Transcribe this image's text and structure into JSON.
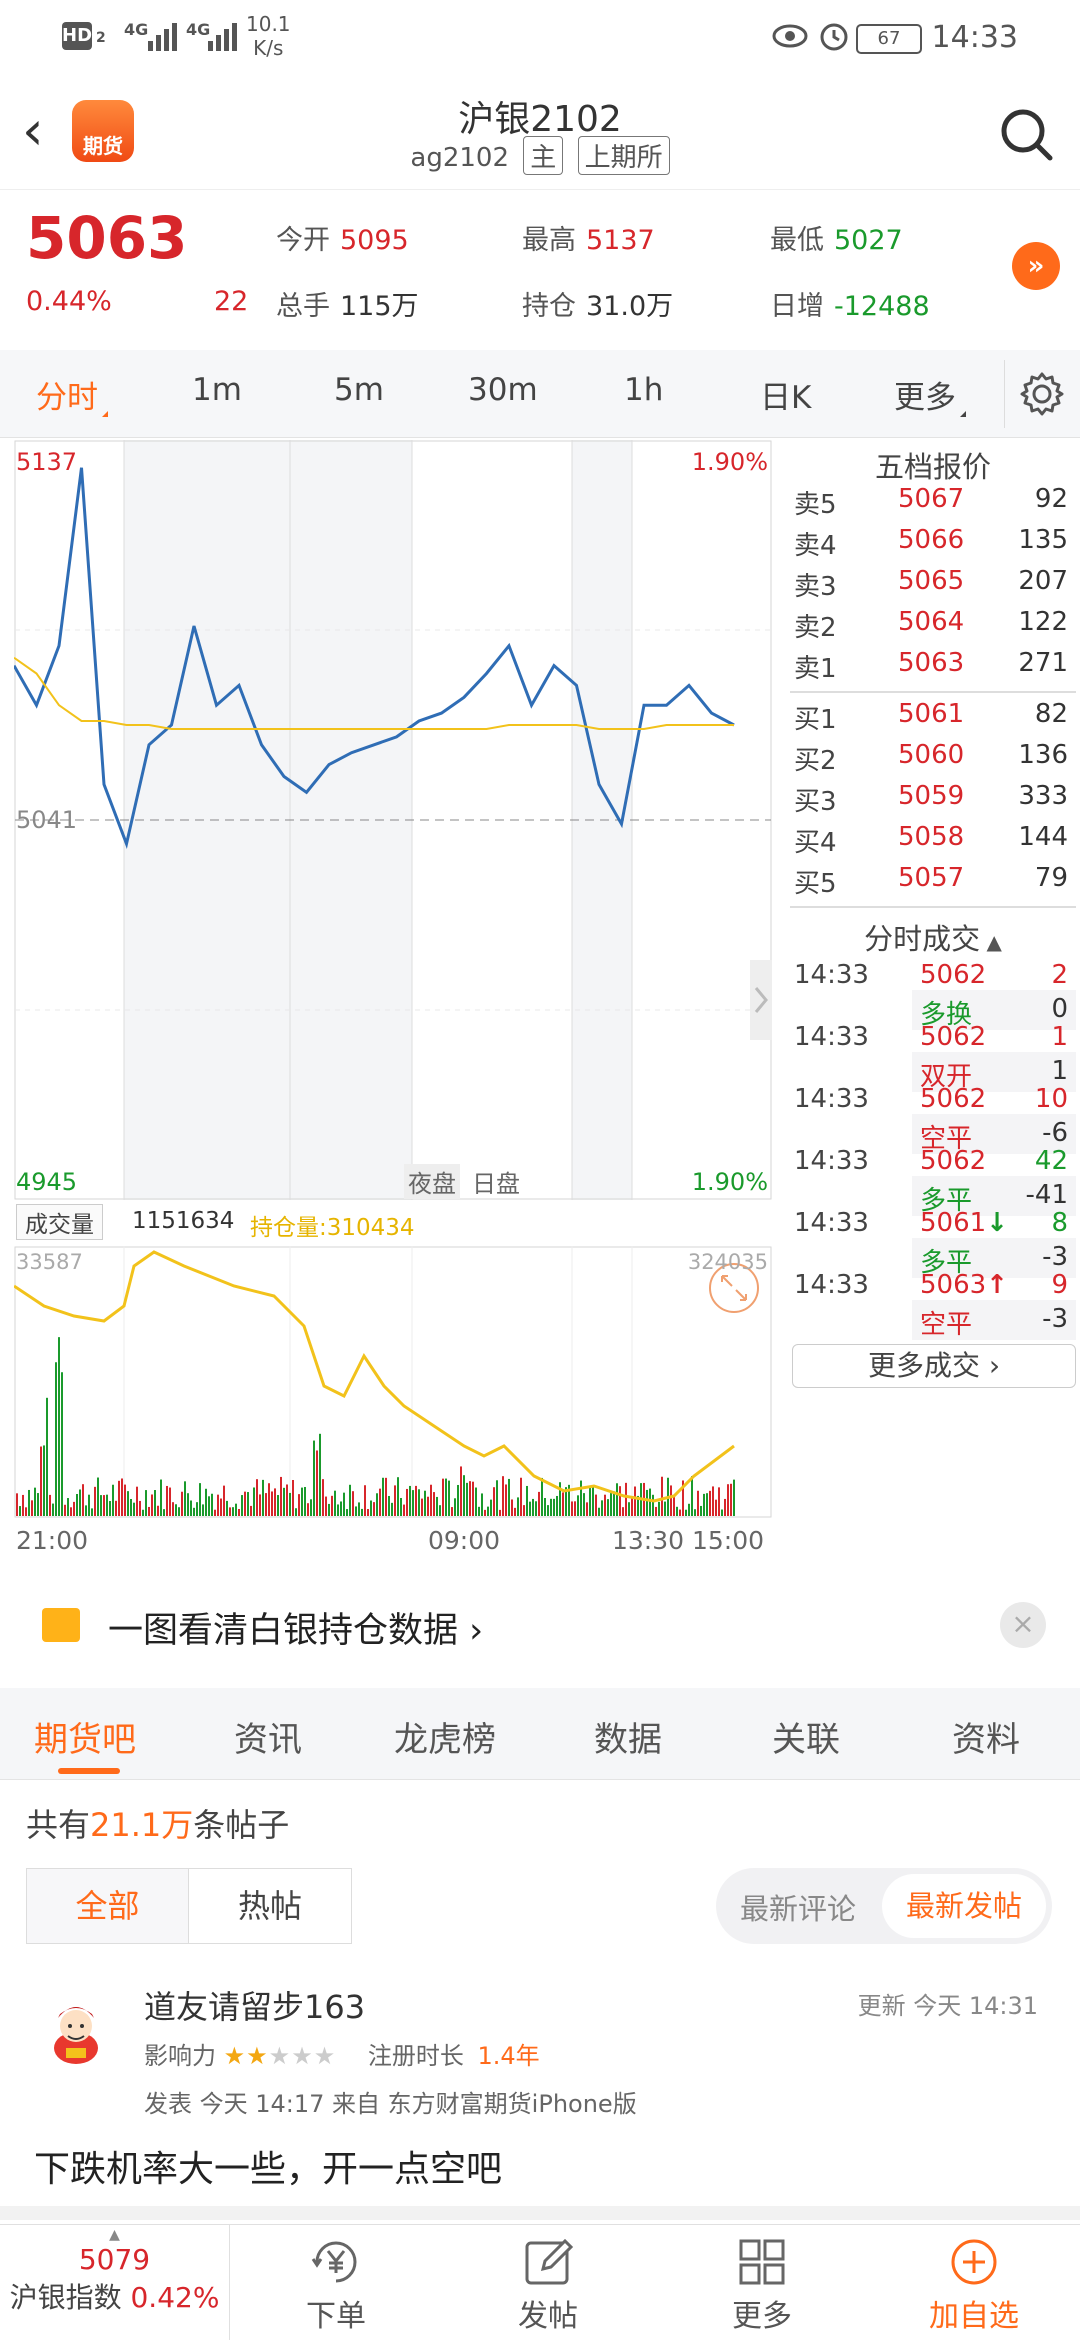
{
  "status": {
    "hd": "HD",
    "hd_num": "2",
    "sig1": "4G",
    "sig2": "4G",
    "speed": "10.1",
    "speed_unit": "K/s",
    "battery": "67",
    "time": "14:33"
  },
  "header": {
    "logo_text": "期货",
    "title": "沪银2102",
    "code": "ag2102",
    "tag_main": "主",
    "exchange": "上期所"
  },
  "quote": {
    "price": "5063",
    "change_pct": "0.44%",
    "change_val": "22",
    "open_label": "今开",
    "open": "5095",
    "high_label": "最高",
    "high": "5137",
    "low_label": "最低",
    "low": "5027",
    "volume_label": "总手",
    "volume": "115万",
    "oi_label": "持仓",
    "oi": "31.0万",
    "daily_label": "日增",
    "daily": "-12488"
  },
  "periods": [
    "分时",
    "1m",
    "5m",
    "30m",
    "1h",
    "日K",
    "更多"
  ],
  "chart": {
    "top_price": "5137",
    "top_pct": "1.90%",
    "mid_price": "5041",
    "bottom_price": "4945",
    "bottom_pct": "1.90%",
    "night_label": "夜盘",
    "day_label": "日盘",
    "vol_tag": "成交量",
    "vol_value": "1151634",
    "oi_value_label": "持仓量:310434",
    "vol_top_left": "33587",
    "vol_top_right": "324035",
    "time_axis": [
      "21:00",
      "09:00",
      "13:30",
      "15:00"
    ]
  },
  "chart_data": {
    "type": "line",
    "title": "",
    "xlabel": "",
    "ylabel": "",
    "ylim": [
      4945,
      5137
    ],
    "x_ticks": [
      "21:00",
      "09:00",
      "13:30",
      "15:00"
    ],
    "series": [
      {
        "name": "",
        "values": [
          5080,
          5070,
          5085,
          5130,
          5050,
          5035,
          5060,
          5065,
          5090,
          5070,
          5075,
          5060,
          5052,
          5048,
          5055,
          5058,
          5060,
          5062,
          5066,
          5068,
          5072,
          5078,
          5085,
          5070,
          5080,
          5075,
          5050,
          5040,
          5070,
          5070,
          5075,
          5068,
          5065
        ]
      },
      {
        "name": "",
        "values": [
          5082,
          5078,
          5070,
          5066,
          5066,
          5065,
          5065,
          5064,
          5064,
          5064,
          5064,
          5064,
          5064,
          5064,
          5064,
          5064,
          5064,
          5064,
          5064,
          5064,
          5064,
          5064,
          5065,
          5065,
          5065,
          5065,
          5064,
          5064,
          5064,
          5065,
          5065,
          5065,
          5065
        ]
      }
    ]
  },
  "book": {
    "title": "五档报价",
    "asks": [
      {
        "label": "卖5",
        "price": "5067",
        "vol": "92"
      },
      {
        "label": "卖4",
        "price": "5066",
        "vol": "135"
      },
      {
        "label": "卖3",
        "price": "5065",
        "vol": "207"
      },
      {
        "label": "卖2",
        "price": "5064",
        "vol": "122"
      },
      {
        "label": "卖1",
        "price": "5063",
        "vol": "271"
      }
    ],
    "bids": [
      {
        "label": "买1",
        "price": "5061",
        "vol": "82"
      },
      {
        "label": "买2",
        "price": "5060",
        "vol": "136"
      },
      {
        "label": "买3",
        "price": "5059",
        "vol": "333"
      },
      {
        "label": "买4",
        "price": "5058",
        "vol": "144"
      },
      {
        "label": "买5",
        "price": "5057",
        "vol": "79"
      }
    ]
  },
  "ticks": {
    "title": "分时成交",
    "rows": [
      {
        "time": "14:33",
        "price": "5062",
        "vol": "2",
        "type": "多换",
        "chg": "0"
      },
      {
        "time": "14:33",
        "price": "5062",
        "vol": "1",
        "type": "双开",
        "chg": "1"
      },
      {
        "time": "14:33",
        "price": "5062",
        "vol": "10",
        "type": "空平",
        "chg": "-6"
      },
      {
        "time": "14:33",
        "price": "5062",
        "vol": "42",
        "type": "多平",
        "chg": "-41"
      },
      {
        "time": "14:33",
        "price": "5061",
        "arrow": "↓",
        "vol": "8",
        "type": "多平",
        "chg": "-3"
      },
      {
        "time": "14:33",
        "price": "5063",
        "arrow": "↑",
        "vol": "9",
        "type": "空平",
        "chg": "-3"
      }
    ],
    "more": "更多成交 ›"
  },
  "banner": {
    "text": "一图看清白银持仓数据 ›",
    "close": "×"
  },
  "forum_tabs": [
    "期货吧",
    "资讯",
    "龙虎榜",
    "数据",
    "关联",
    "资料"
  ],
  "forum": {
    "count_prefix": "共有",
    "count": "21.1万",
    "count_suffix": "条帖子",
    "seg_all": "全部",
    "seg_hot": "热帖",
    "sort_comment": "最新评论",
    "sort_post": "最新发帖"
  },
  "post": {
    "user": "道友请留步163",
    "updated": "更新 今天 14:31",
    "influence_label": "影响力",
    "stars_on": "★★",
    "stars_off": "★★★",
    "reg_label": "注册时长",
    "reg_value": "1.4年",
    "posted": "发表 今天 14:17   来自 东方财富期货iPhone版",
    "text": "下跌机率大一些，开一点空吧"
  },
  "bottom": {
    "index_value": "5079",
    "index_name": "沪银指数",
    "index_pct": "0.42%",
    "nav": [
      "下单",
      "发帖",
      "更多",
      "加自选"
    ]
  },
  "colors": {
    "up": "#d7262b",
    "down": "#1a9a2c",
    "accent": "#ff6a1a",
    "line": "#2f6db5",
    "avg": "#f2c21b"
  }
}
